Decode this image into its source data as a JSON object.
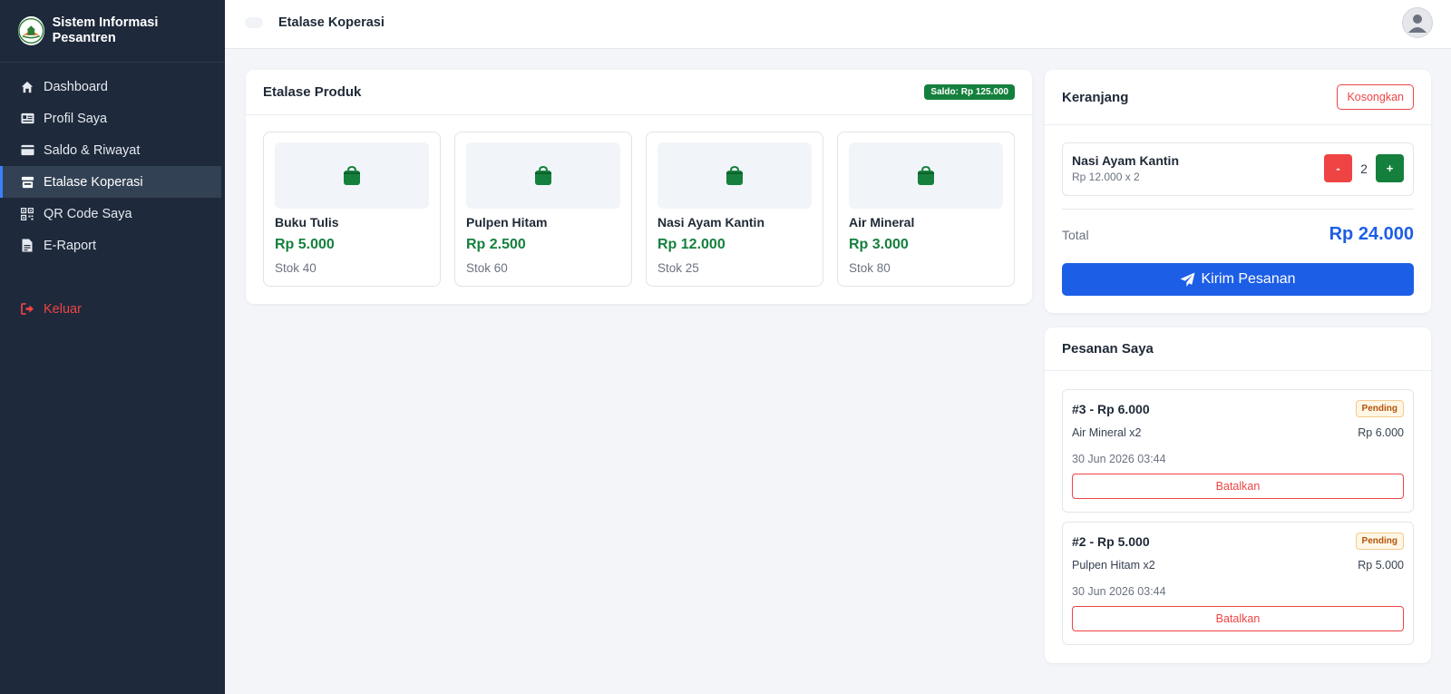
{
  "sidebar": {
    "brand": "Sistem Informasi Pesantren",
    "items": [
      {
        "label": "Dashboard",
        "icon": "home-icon"
      },
      {
        "label": "Profil Saya",
        "icon": "id-card-icon"
      },
      {
        "label": "Saldo & Riwayat",
        "icon": "wallet-icon"
      },
      {
        "label": "Etalase Koperasi",
        "icon": "store-icon"
      },
      {
        "label": "QR Code Saya",
        "icon": "qrcode-icon"
      },
      {
        "label": "E-Raport",
        "icon": "document-icon"
      }
    ],
    "logout": "Keluar",
    "active_index": 3
  },
  "topbar": {
    "title": "Etalase Koperasi"
  },
  "etalase": {
    "title": "Etalase Produk",
    "saldo": "Saldo: Rp 125.000",
    "products": [
      {
        "name": "Buku Tulis",
        "price": "Rp 5.000",
        "stock": "Stok 40"
      },
      {
        "name": "Pulpen Hitam",
        "price": "Rp 2.500",
        "stock": "Stok 60"
      },
      {
        "name": "Nasi Ayam Kantin",
        "price": "Rp 12.000",
        "stock": "Stok 25"
      },
      {
        "name": "Air Mineral",
        "price": "Rp 3.000",
        "stock": "Stok 80"
      }
    ]
  },
  "cart": {
    "title": "Keranjang",
    "clear_label": "Kosongkan",
    "item": {
      "name": "Nasi Ayam Kantin",
      "detail": "Rp 12.000 x 2",
      "qty": "2",
      "minus": "-",
      "plus": "+"
    },
    "total_label": "Total",
    "total_value": "Rp 24.000",
    "send_label": "Kirim Pesanan"
  },
  "orders": {
    "title": "Pesanan Saya",
    "list": [
      {
        "title": "#3 - Rp 6.000",
        "status": "Pending",
        "item": "Air Mineral x2",
        "amount": "Rp 6.000",
        "date": "30 Jun 2026 03:44",
        "cancel": "Batalkan"
      },
      {
        "title": "#2 - Rp 5.000",
        "status": "Pending",
        "item": "Pulpen Hitam x2",
        "amount": "Rp 5.000",
        "date": "30 Jun 2026 03:44",
        "cancel": "Batalkan"
      }
    ]
  },
  "colors": {
    "sidebar_bg": "#1e293b",
    "accent_blue": "#1d5ee6",
    "price_green": "#15803d",
    "danger_red": "#ef4444"
  }
}
